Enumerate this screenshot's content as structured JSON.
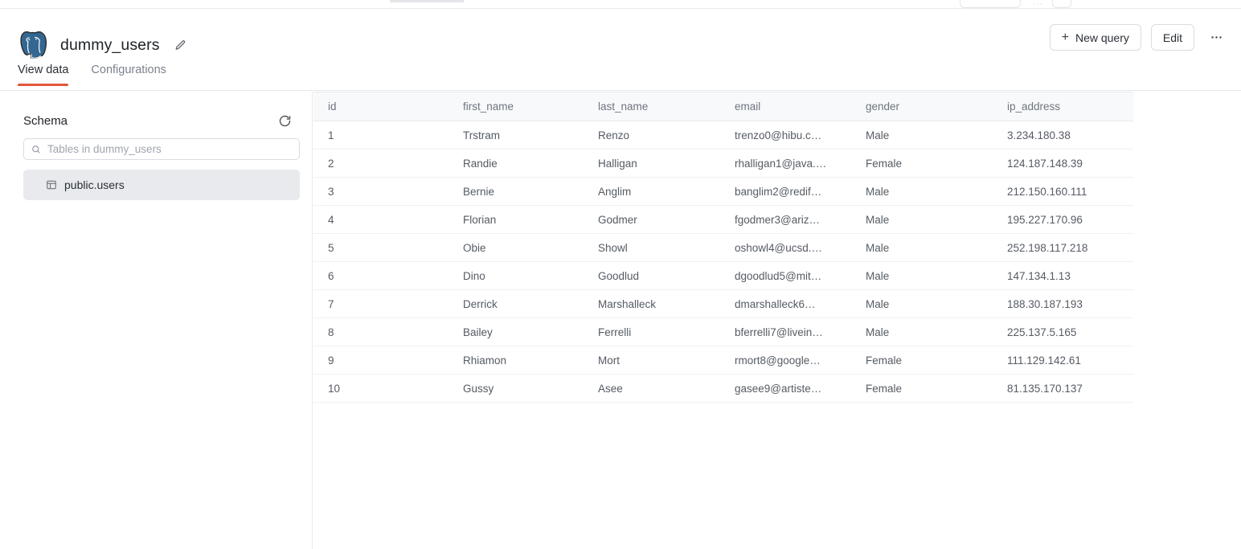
{
  "window": {
    "ghost_more_dots": "···"
  },
  "header": {
    "logo_icon": "postgresql-elephant-icon",
    "title": "dummy_users",
    "edit_title_icon": "pencil-icon",
    "new_query_label": "New query",
    "new_query_icon": "plus-icon",
    "edit_label": "Edit",
    "more_icon": "ellipsis-horizontal-icon"
  },
  "tabs": [
    {
      "label": "View data",
      "active": true
    },
    {
      "label": "Configurations",
      "active": false
    }
  ],
  "sidebar": {
    "title": "Schema",
    "refresh_icon": "refresh-icon",
    "search": {
      "icon": "search-icon",
      "placeholder": "Tables in dummy_users",
      "value": ""
    },
    "tables": [
      {
        "label": "public.users",
        "icon": "table-icon",
        "selected": true
      }
    ]
  },
  "grid": {
    "columns": [
      "id",
      "first_name",
      "last_name",
      "email",
      "gender",
      "ip_address"
    ],
    "rows": [
      {
        "id": "1",
        "first_name": "Trstram",
        "last_name": "Renzo",
        "email": "trenzo0@hibu.c…",
        "gender": "Male",
        "ip_address": "3.234.180.38"
      },
      {
        "id": "2",
        "first_name": "Randie",
        "last_name": "Halligan",
        "email": "rhalligan1@java.…",
        "gender": "Female",
        "ip_address": "124.187.148.39"
      },
      {
        "id": "3",
        "first_name": "Bernie",
        "last_name": "Anglim",
        "email": "banglim2@redif…",
        "gender": "Male",
        "ip_address": "212.150.160.111"
      },
      {
        "id": "4",
        "first_name": "Florian",
        "last_name": "Godmer",
        "email": "fgodmer3@ariz…",
        "gender": "Male",
        "ip_address": "195.227.170.96"
      },
      {
        "id": "5",
        "first_name": "Obie",
        "last_name": "Showl",
        "email": "oshowl4@ucsd.…",
        "gender": "Male",
        "ip_address": "252.198.117.218"
      },
      {
        "id": "6",
        "first_name": "Dino",
        "last_name": "Goodlud",
        "email": "dgoodlud5@mit…",
        "gender": "Male",
        "ip_address": "147.134.1.13"
      },
      {
        "id": "7",
        "first_name": "Derrick",
        "last_name": "Marshalleck",
        "email": "dmarshalleck6…",
        "gender": "Male",
        "ip_address": "188.30.187.193"
      },
      {
        "id": "8",
        "first_name": "Bailey",
        "last_name": "Ferrelli",
        "email": "bferrelli7@livein…",
        "gender": "Male",
        "ip_address": "225.137.5.165"
      },
      {
        "id": "9",
        "first_name": "Rhiamon",
        "last_name": "Mort",
        "email": "rmort8@google…",
        "gender": "Female",
        "ip_address": "111.129.142.61"
      },
      {
        "id": "10",
        "first_name": "Gussy",
        "last_name": "Asee",
        "email": "gasee9@artiste…",
        "gender": "Female",
        "ip_address": "81.135.170.137"
      }
    ]
  },
  "colors": {
    "accent": "#e3573b",
    "selected_row": "#e8eaee",
    "header_bg": "#f8f9fb",
    "border": "#e7e9ec",
    "logo_blue": "#336791"
  }
}
